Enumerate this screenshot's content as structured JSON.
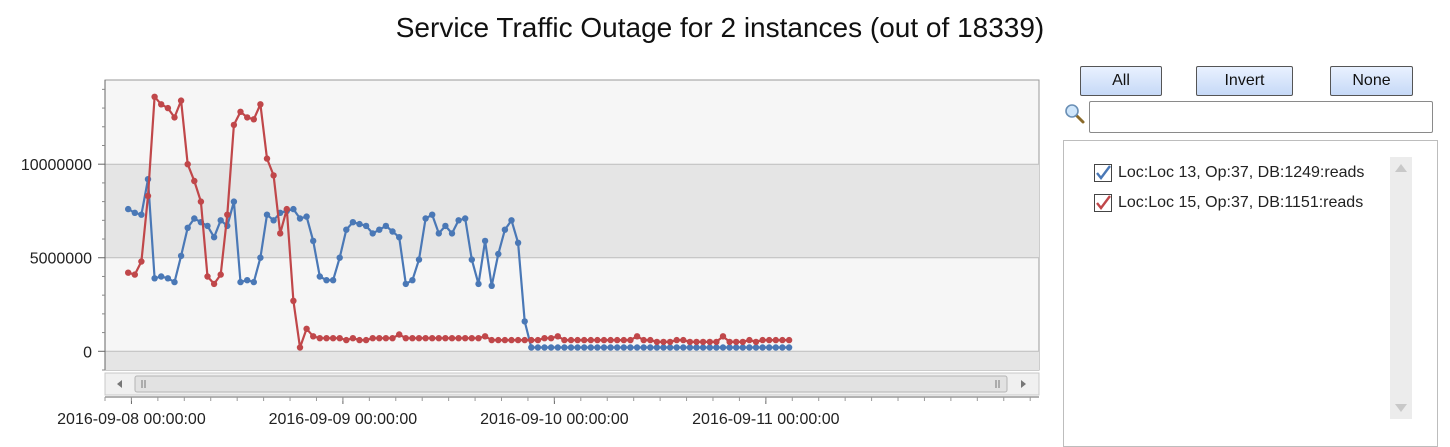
{
  "title": "Service Traffic Outage for 2 instances (out of 18339)",
  "buttons": {
    "all": "All",
    "invert": "Invert",
    "none": "None"
  },
  "search": {
    "value": "",
    "placeholder": ""
  },
  "icons": {
    "search": "search-icon",
    "scroll_left": "arrow-left-icon",
    "scroll_right": "arrow-right-icon",
    "scroll_up": "arrow-up-icon",
    "scroll_down": "arrow-down-icon",
    "grip": "grip-icon"
  },
  "series_list": [
    {
      "label": "Loc:Loc 13, Op:37, DB:1249:reads",
      "checked": true,
      "color": "#4a78b6"
    },
    {
      "label": "Loc:Loc 15, Op:37, DB:1151:reads",
      "checked": true,
      "color": "#c0474a"
    }
  ],
  "chart_data": {
    "type": "line",
    "x_start": "2016-09-07 23:38",
    "x_step_hours": 0.75,
    "xlim": [
      "2016-09-07 21:00",
      "2016-09-12 07:00"
    ],
    "x_tick_labels": [
      "2016-09-08 00:00:00",
      "2016-09-09 00:00:00",
      "2016-09-10 00:00:00",
      "2016-09-11 00:00:00"
    ],
    "ylim": [
      -1000000,
      14500000
    ],
    "y_ticks": [
      0,
      5000000,
      10000000
    ],
    "y_tick_labels": [
      "0",
      "5000000",
      "10000000"
    ],
    "grid": true,
    "colors": {
      "blue": "#4a78b6",
      "red": "#c0474a",
      "band": "#e5e5e5",
      "plot_bg": "#f6f6f6"
    },
    "series": [
      {
        "color": "#4a78b6",
        "values": [
          7600000,
          7400000,
          7300000,
          9200000,
          3900000,
          4000000,
          3900000,
          3700000,
          5100000,
          6600000,
          7100000,
          6900000,
          6700000,
          6100000,
          7000000,
          6700000,
          8000000,
          3700000,
          3800000,
          3700000,
          5000000,
          7300000,
          7000000,
          7400000,
          7500000,
          7600000,
          7100000,
          7200000,
          5900000,
          4000000,
          3800000,
          3800000,
          5000000,
          6500000,
          6900000,
          6800000,
          6700000,
          6300000,
          6500000,
          6700000,
          6400000,
          6100000,
          3600000,
          3800000,
          4900000,
          7100000,
          7300000,
          6300000,
          6700000,
          6300000,
          7000000,
          7100000,
          4900000,
          3600000,
          5900000,
          3500000,
          5200000,
          6500000,
          7000000,
          5800000,
          1600000,
          200000,
          200000,
          200000,
          200000,
          200000,
          200000,
          200000,
          200000,
          200000,
          200000,
          200000,
          200000,
          200000,
          200000,
          200000,
          200000,
          200000,
          200000,
          200000,
          200000,
          200000,
          200000,
          200000,
          200000,
          200000,
          200000,
          200000,
          200000,
          200000,
          200000,
          200000,
          200000,
          200000,
          200000,
          200000,
          200000,
          200000,
          200000,
          200000,
          200000
        ]
      },
      {
        "color": "#c0474a",
        "values": [
          4200000,
          4100000,
          4800000,
          8300000,
          13600000,
          13200000,
          13000000,
          12500000,
          13400000,
          10000000,
          9100000,
          8000000,
          4000000,
          3600000,
          4100000,
          7300000,
          12100000,
          12800000,
          12500000,
          12400000,
          13200000,
          10300000,
          9400000,
          6300000,
          7600000,
          2700000,
          200000,
          1200000,
          800000,
          700000,
          700000,
          700000,
          700000,
          600000,
          700000,
          600000,
          600000,
          700000,
          700000,
          700000,
          700000,
          900000,
          700000,
          700000,
          700000,
          700000,
          700000,
          700000,
          700000,
          700000,
          700000,
          700000,
          700000,
          700000,
          800000,
          600000,
          600000,
          600000,
          600000,
          600000,
          600000,
          600000,
          600000,
          700000,
          700000,
          800000,
          600000,
          600000,
          600000,
          600000,
          600000,
          600000,
          600000,
          600000,
          600000,
          600000,
          600000,
          800000,
          600000,
          600000,
          500000,
          500000,
          500000,
          600000,
          600000,
          500000,
          500000,
          500000,
          500000,
          500000,
          800000,
          500000,
          500000,
          500000,
          600000,
          500000,
          600000,
          600000,
          600000,
          600000,
          600000
        ]
      }
    ]
  }
}
